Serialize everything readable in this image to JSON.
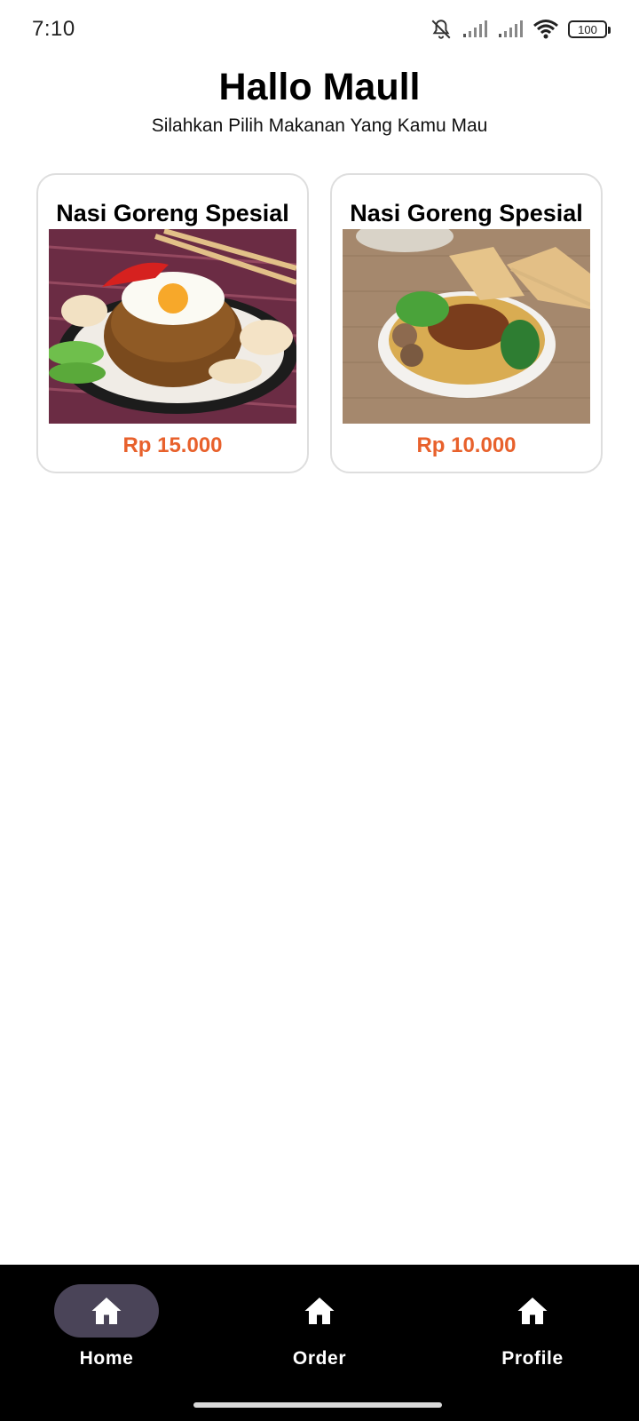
{
  "status_bar": {
    "time": "7:10",
    "battery": "100",
    "icons": [
      "bell-off-icon",
      "signal-icon",
      "signal-icon",
      "wifi-icon",
      "battery-icon"
    ]
  },
  "header": {
    "greeting": "Hallo Maull",
    "subtitle": "Silahkan Pilih Makanan Yang Kamu Mau"
  },
  "menu": {
    "items": [
      {
        "title": "Nasi Goreng Spesial",
        "price": "Rp 15.000",
        "image": "fried-rice-photo"
      },
      {
        "title": "Nasi Goreng Spesial",
        "price": "Rp 10.000",
        "image": "noodle-bowl-photo"
      }
    ]
  },
  "bottom_nav": {
    "items": [
      {
        "label": "Home",
        "icon": "home-icon",
        "active": true
      },
      {
        "label": "Order",
        "icon": "home-icon",
        "active": false
      },
      {
        "label": "Profile",
        "icon": "home-icon",
        "active": false
      }
    ]
  },
  "colors": {
    "price": "#e8612c",
    "nav_background": "#000000",
    "nav_active_pill": "#4a4458",
    "card_border": "#dedede"
  }
}
